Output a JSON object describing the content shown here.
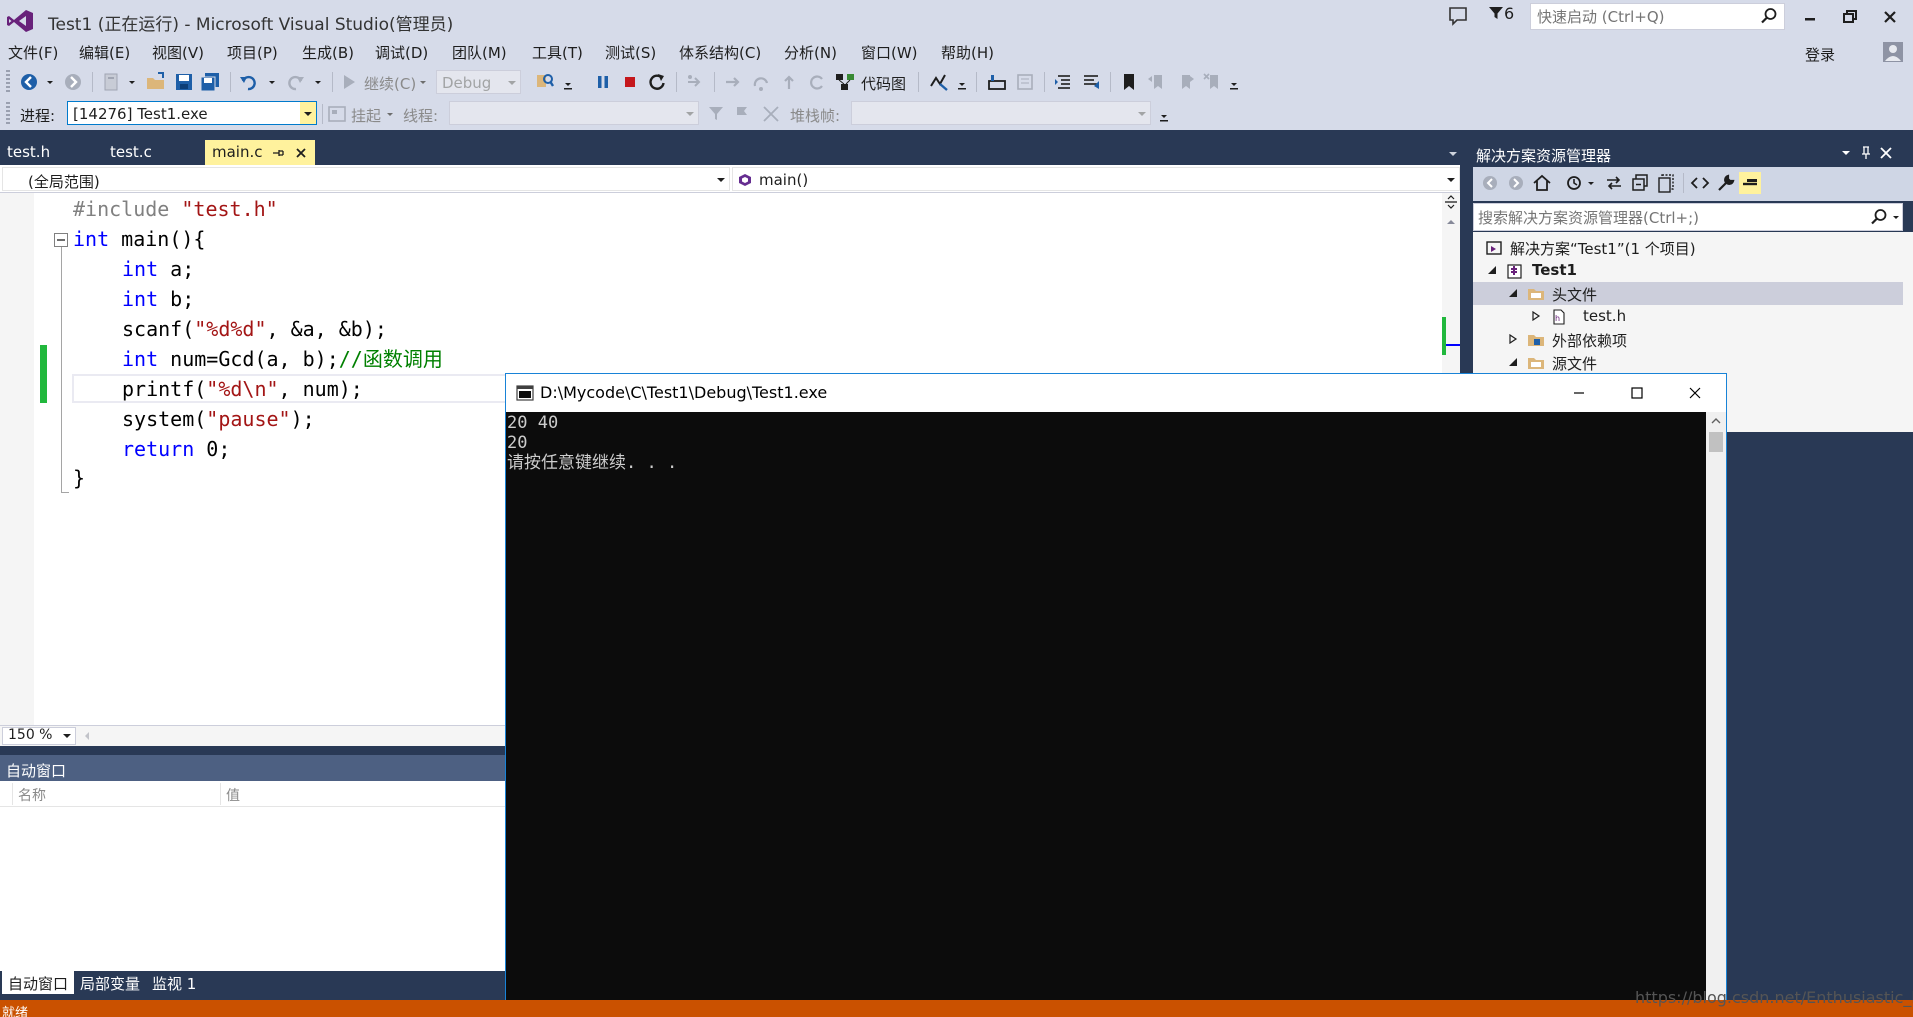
{
  "window": {
    "title": "Test1 (正在运行) - Microsoft Visual Studio(管理员)",
    "notification_count": "6",
    "quick_launch_placeholder": "快速启动 (Ctrl+Q)",
    "login_label": "登录"
  },
  "menu": [
    {
      "label": "文件(F)"
    },
    {
      "label": "编辑(E)"
    },
    {
      "label": "视图(V)"
    },
    {
      "label": "项目(P)"
    },
    {
      "label": "生成(B)"
    },
    {
      "label": "调试(D)"
    },
    {
      "label": "团队(M)"
    },
    {
      "label": "工具(T)"
    },
    {
      "label": "测试(S)"
    },
    {
      "label": "体系结构(C)"
    },
    {
      "label": "分析(N)"
    },
    {
      "label": "窗口(W)"
    },
    {
      "label": "帮助(H)"
    }
  ],
  "toolbar": {
    "continue_label": "继续(C)",
    "config_value": "Debug",
    "code_map_label": "代码图",
    "process_label": "进程:",
    "process_value": "[14276] Test1.exe",
    "suspend_label": "挂起",
    "thread_label": "线程:",
    "stack_frame_label": "堆栈帧:"
  },
  "editor": {
    "tabs": [
      {
        "label": "test.h"
      },
      {
        "label": "test.c"
      },
      {
        "label": "main.c"
      }
    ],
    "scope": "(全局范围)",
    "member": "main()",
    "zoom": "150 %",
    "code": {
      "l1_pp": "#include ",
      "l1_str": "\"test.h\"",
      "l2_kw": "int",
      "l2_rest": " main(){",
      "l3_kw": "int",
      "l3_rest": " a;",
      "l4_kw": "int",
      "l4_rest": " b;",
      "l5_a": "scanf(",
      "l5_str": "\"%d%d\"",
      "l5_b": ", &a, &b);",
      "l6_kw": "int",
      "l6_rest": " num=Gcd(a, b);",
      "l6_cmt": "//函数调用",
      "l7_a": "printf(",
      "l7_str": "\"%d\\n\"",
      "l7_b": ", num);",
      "l8_a": "system(",
      "l8_str": "\"pause\"",
      "l8_b": ");",
      "l9_kw": "return",
      "l9_rest": " 0;",
      "l10": "}"
    }
  },
  "autos": {
    "title": "自动窗口",
    "col_name": "名称",
    "col_value": "值",
    "tabs": [
      {
        "label": "自动窗口"
      },
      {
        "label": "局部变量"
      },
      {
        "label": "监视 1"
      }
    ]
  },
  "solution_explorer": {
    "title": "解决方案资源管理器",
    "search_placeholder": "搜索解决方案资源管理器(Ctrl+;)",
    "tree": [
      {
        "label": "解决方案“Test1”(1 个项目)"
      },
      {
        "label": "Test1"
      },
      {
        "label": "头文件"
      },
      {
        "label": "test.h"
      },
      {
        "label": "外部依赖项"
      },
      {
        "label": "源文件"
      }
    ]
  },
  "console": {
    "title": "D:\\Mycode\\C\\Test1\\Debug\\Test1.exe",
    "lines": [
      "20 40",
      "20",
      "请按任意键继续. . ."
    ]
  },
  "status": {
    "text": "就绪"
  },
  "watermark": "https://blog.csdn.net/Enthusiastic_boy",
  "colors": {
    "accent": "#007ACC",
    "chrome": "#D6DBE9",
    "frame": "#293955",
    "active_tab": "#FFF29D",
    "status_bar": "#CA5100"
  }
}
